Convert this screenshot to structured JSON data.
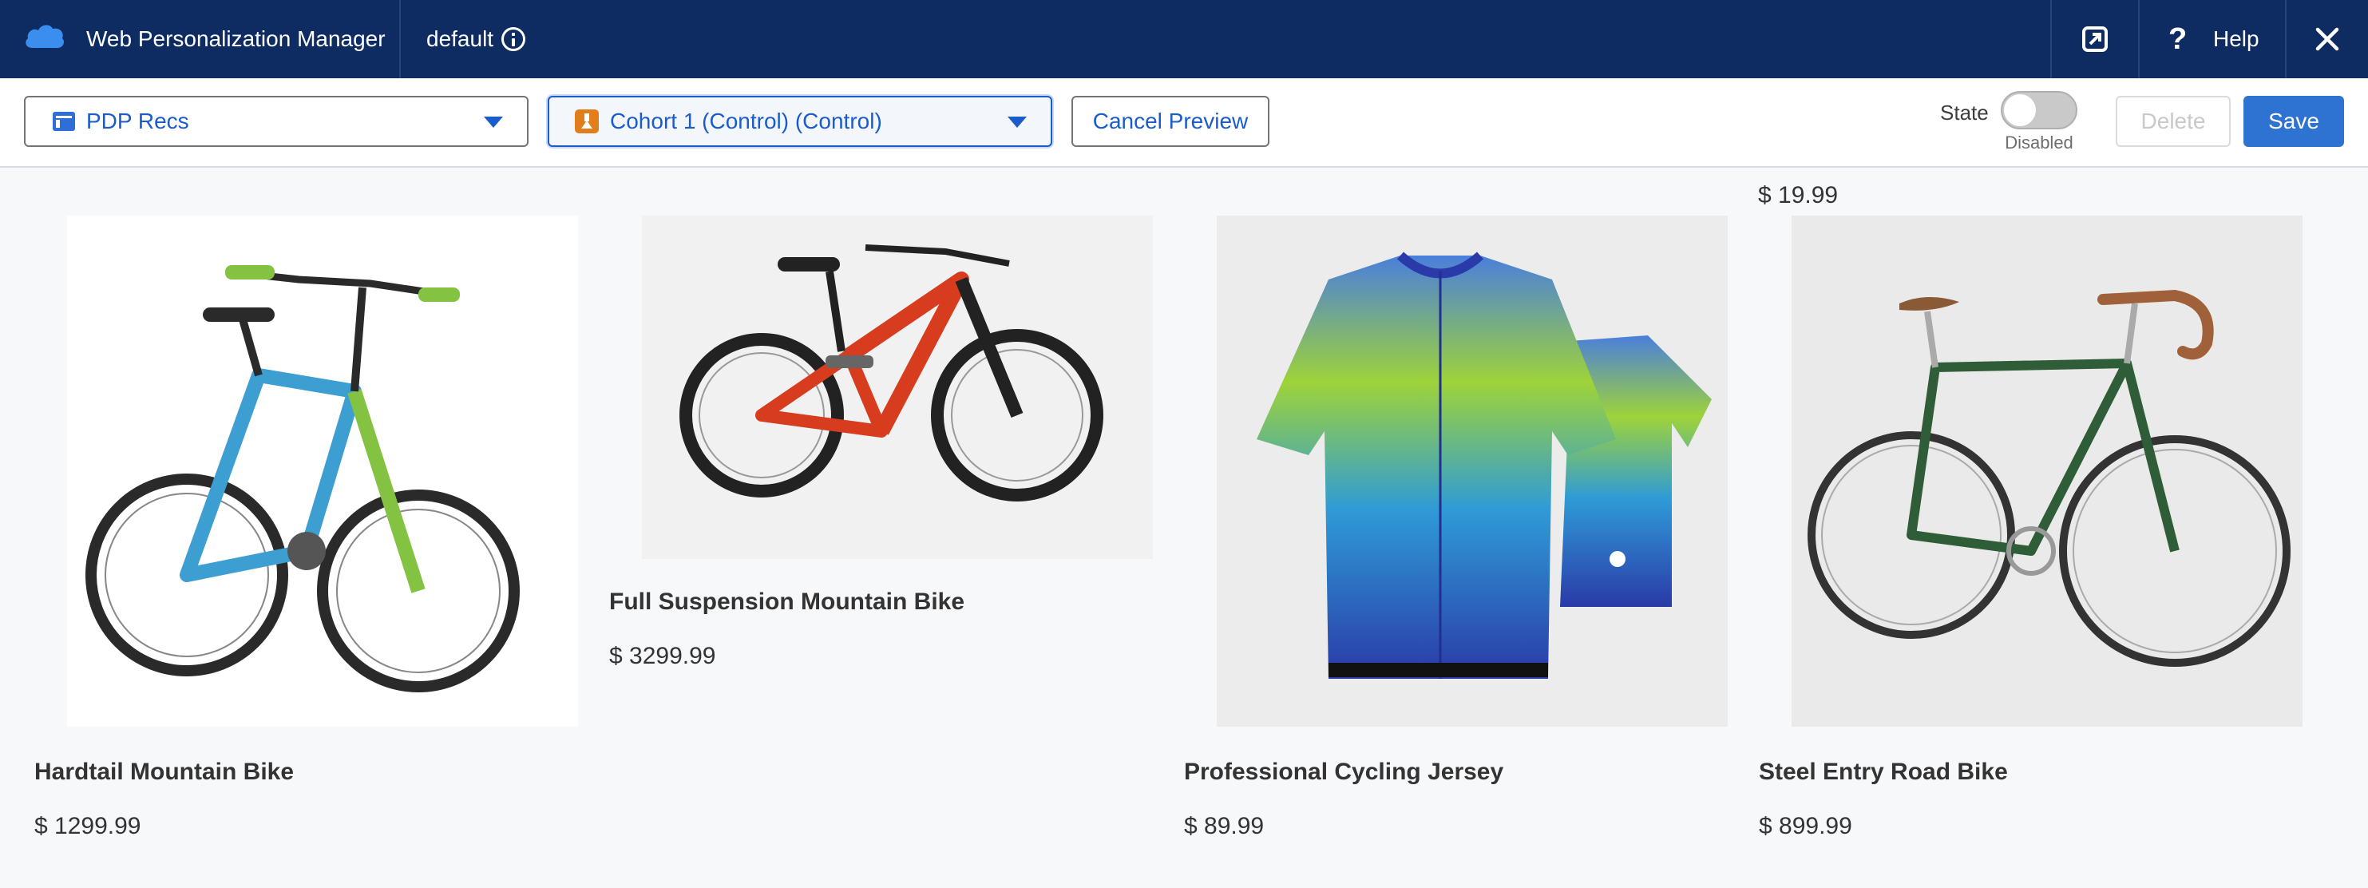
{
  "header": {
    "app_title": "Web Personalization Manager",
    "site_name": "default",
    "help_label": "Help",
    "icons": [
      "cloud-logo-icon",
      "info-icon",
      "external-link-icon",
      "help-icon",
      "close-icon"
    ]
  },
  "toolbar": {
    "experience_select": "PDP Recs",
    "cohort_select": "Cohort 1 (Control) (Control)",
    "cancel_preview": "Cancel Preview",
    "state_label": "State",
    "state_value": "Disabled",
    "state_on": false,
    "delete_label": "Delete",
    "save_label": "Save"
  },
  "content": {
    "partial_price": "$ 19.99",
    "products": [
      {
        "name": "Hardtail Mountain Bike",
        "price": "$ 1299.99"
      },
      {
        "name": "Full Suspension Mountain Bike",
        "price": "$ 3299.99"
      },
      {
        "name": "Professional Cycling Jersey",
        "price": "$ 89.99"
      },
      {
        "name": "Steel Entry Road Bike",
        "price": "$ 899.99"
      }
    ]
  },
  "colors": {
    "header_bg": "#0e2b62",
    "brand_blue": "#2e72d2",
    "link_blue": "#1b5ccd",
    "flask_orange": "#e07e1c"
  }
}
